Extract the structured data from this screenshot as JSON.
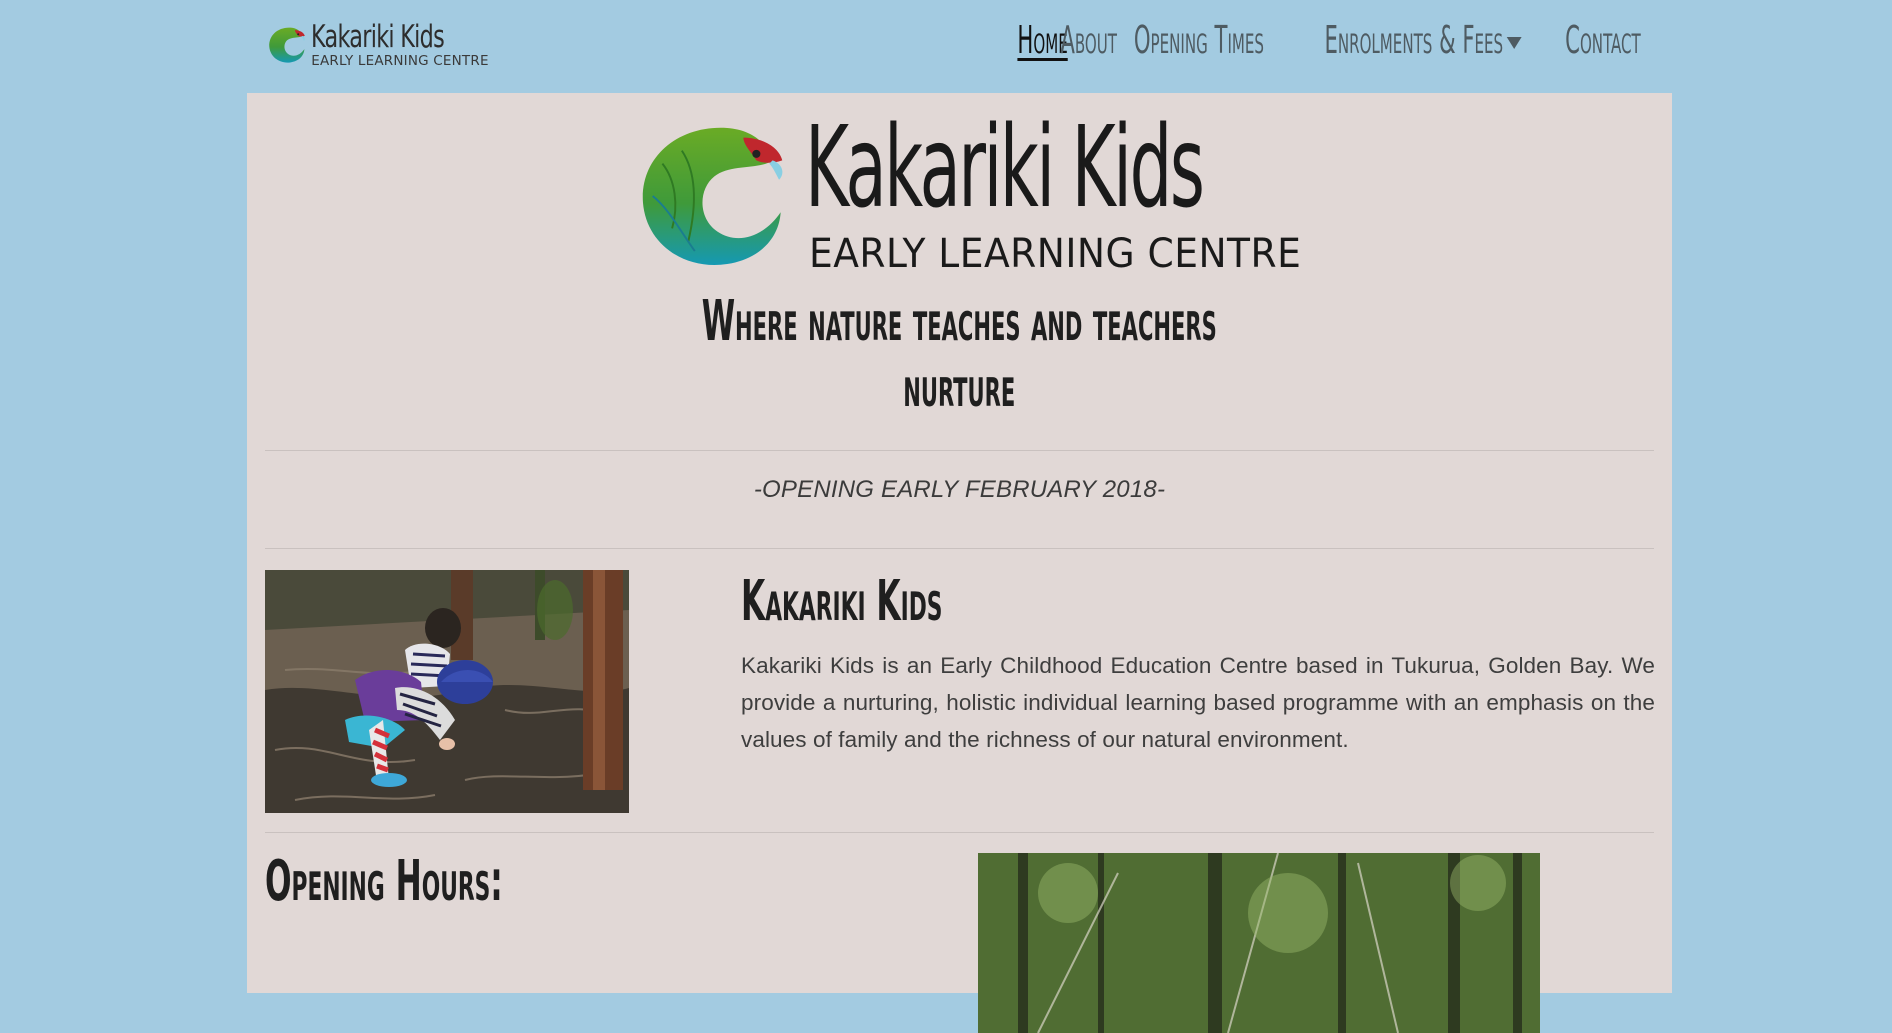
{
  "nav": {
    "logo": {
      "title": "Kakariki Kids",
      "subtitle": "EARLY LEARNING CENTRE"
    },
    "links": [
      {
        "label": "Home",
        "active": true
      },
      {
        "label": "About",
        "active": false
      },
      {
        "label": "Opening Times",
        "active": false
      },
      {
        "label": "Enrolments & Fees",
        "active": false,
        "dropdown": true
      },
      {
        "label": "Contact",
        "active": false
      }
    ]
  },
  "hero": {
    "title": "Kakariki Kids",
    "subtitle": "EARLY LEARNING CENTRE",
    "tagline": [
      "Where nature teaches and teachers",
      "nurture"
    ]
  },
  "announcement": "-OPENING EARLY FEBRUARY 2018-",
  "about": {
    "heading": "Kakariki Kids",
    "body": "Kakariki Kids is an Early Childhood Education Centre based in Tukurua, Golden Bay. We provide a nurturing, holistic individual learning based programme with an emphasis on the values of family and the richness of our natural environment."
  },
  "hours": {
    "heading": "Opening Hours:"
  },
  "colors": {
    "page_background": "#a3cbe1",
    "panel_background": "#e1d8d6",
    "nav_text": "#4e5b62",
    "parrot_green": "#5a9e2a",
    "parrot_teal": "#1b9aa8",
    "parrot_red": "#c0272d"
  },
  "icons": {
    "logo": "kakariki-parrot-logo-icon",
    "dropdown": "caret-down-icon"
  }
}
